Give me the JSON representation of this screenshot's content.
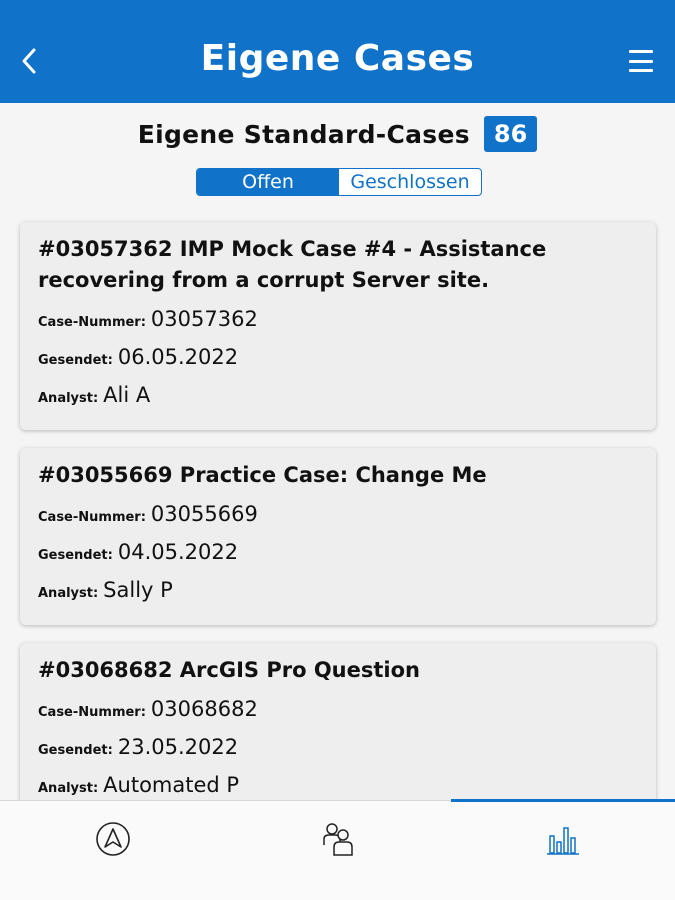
{
  "header": {
    "title": "Eigene Cases",
    "back_icon": "chevron-left-icon",
    "menu_icon": "hamburger-menu-icon"
  },
  "subheader": {
    "title": "Eigene Standard-Cases",
    "count": "86"
  },
  "filter": {
    "open_label": "Offen",
    "closed_label": "Geschlossen",
    "selected": "Offen"
  },
  "cases": [
    {
      "title": "#03057362 IMP Mock Case #4 - Assistance recovering from a corrupt Server site.",
      "case_number_label": "Case-Nummer:",
      "case_number": "03057362",
      "sent_label": "Gesendet:",
      "sent": "06.05.2022",
      "analyst_label": "Analyst:",
      "analyst": "Ali A"
    },
    {
      "title": "#03055669 Practice Case: Change Me",
      "case_number_label": "Case-Nummer:",
      "case_number": "03055669",
      "sent_label": "Gesendet:",
      "sent": "04.05.2022",
      "analyst_label": "Analyst:",
      "analyst": "Sally P"
    },
    {
      "title": "#03068682 ArcGIS Pro Question",
      "case_number_label": "Case-Nummer:",
      "case_number": "03068682",
      "sent_label": "Gesendet:",
      "sent": "23.05.2022",
      "analyst_label": "Analyst:",
      "analyst": "Automated P"
    }
  ],
  "tabbar": {
    "tabs": [
      {
        "icon": "navigator-compass-icon",
        "selected": false
      },
      {
        "icon": "community-users-icon",
        "selected": false
      },
      {
        "icon": "bar-chart-icon",
        "selected": true
      }
    ]
  },
  "colors": {
    "primary": "#1072c8",
    "card_bg": "#eeeeee",
    "page_bg": "#f5f5f5"
  }
}
